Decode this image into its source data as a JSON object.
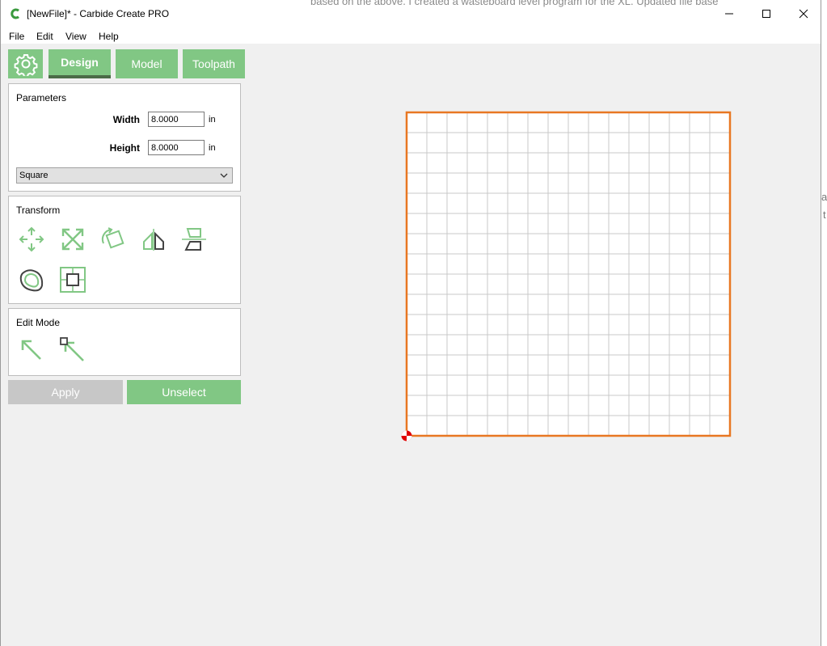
{
  "window": {
    "title": "[NewFile]* - Carbide Create PRO"
  },
  "background_text": {
    "top_line": "based on the above. I created a wasteboard level program for the XL. Updated file base",
    "frag_a": "a",
    "frag_t": "t"
  },
  "menu": {
    "items": [
      {
        "label": "File"
      },
      {
        "label": "Edit"
      },
      {
        "label": "View"
      },
      {
        "label": "Help"
      }
    ]
  },
  "tabs": {
    "settings_icon": "gear-icon",
    "design": "Design",
    "model": "Model",
    "toolpath": "Toolpath",
    "active": "Design"
  },
  "parameters": {
    "title": "Parameters",
    "width_label": "Width",
    "width_value": "8.0000",
    "width_unit": "in",
    "height_label": "Height",
    "height_value": "8.0000",
    "height_unit": "in",
    "shape_type": "Square"
  },
  "transform": {
    "title": "Transform",
    "tools": [
      "move-icon",
      "scale-icon",
      "rotate-icon",
      "mirror-icon",
      "flip-icon",
      "offset-icon",
      "align-icon"
    ]
  },
  "edit_mode": {
    "title": "Edit Mode",
    "tools": [
      "select-arrow-icon",
      "node-edit-icon"
    ]
  },
  "actions": {
    "apply": "Apply",
    "unselect": "Unselect"
  },
  "canvas": {
    "grid_columns": 16,
    "grid_rows": 16,
    "border_color": "#e87722",
    "grid_color": "#c8c8c8",
    "origin_color": "#e00000"
  },
  "colors": {
    "accent": "#81c784",
    "disabled": "#c7c7c7",
    "tab_underline": "#4b6b47"
  }
}
